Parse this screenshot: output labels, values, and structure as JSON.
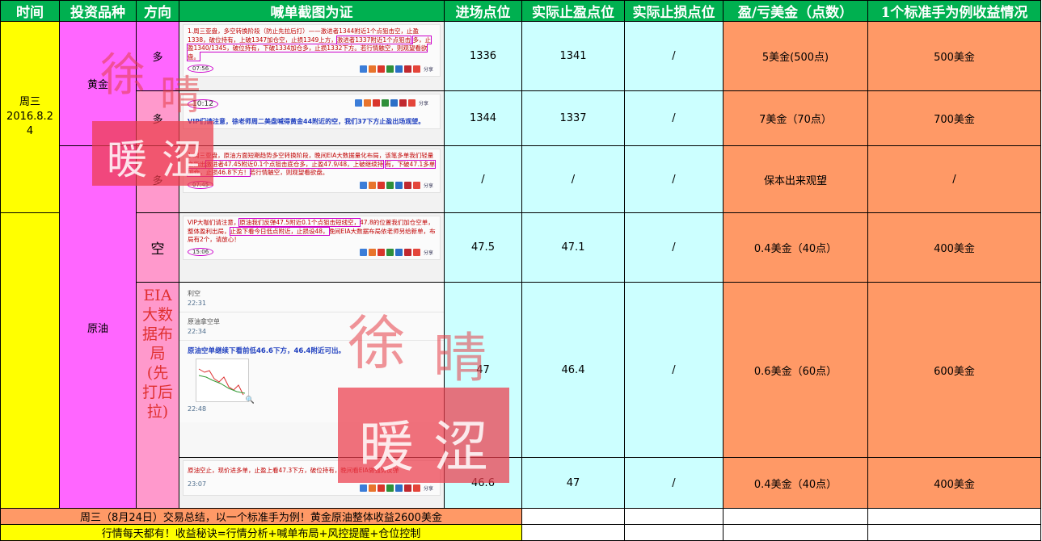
{
  "headers": [
    "时间",
    "投资品种",
    "方向",
    "喊单截图为证",
    "进场点位",
    "实际止盈点位",
    "实际止损点位",
    "盈/亏美金（点数）",
    "1个标准手为例收益情况"
  ],
  "date_cell": "周三\n2016.8.24",
  "instruments": {
    "gold": "黄金",
    "oil": "原油"
  },
  "eia_label": "EIA大数据布局(先打后拉)",
  "rows": [
    {
      "direction": "多",
      "entry": "1336",
      "tp": "1341",
      "sl": "/",
      "pl": "5美金(500点)",
      "profit": "500美金",
      "shot": {
        "line1": "1.周三亚盘，多空转换阶段（防止先拉后打）——激进者1344附近1个点狙击空，止盈1338，破位持有，上破1347加仓空，止损1349上方，",
        "hl1": "激进者1337附近1个点狙击",
        "line2": "多，止盈1340/1345，破位持有，下破1334加仓多，止损1332下方。若行情触空，则观望看欲盘。",
        "time": "07:56"
      }
    },
    {
      "direction": "多",
      "entry": "1344",
      "tp": "1337",
      "sl": "/",
      "pl": "7美金（70点）",
      "profit": "700美金",
      "shot": {
        "time": "10:12",
        "line1": "VIP们请注意，徐老师周二美盘喊得黄金44附近的空，我们37下方止盈出场观望。"
      }
    },
    {
      "direction": "多",
      "entry": "/",
      "tp": "/",
      "sl": "/",
      "pl": "保本出来观望",
      "profit": "/",
      "shot": {
        "line1": "1.周三亚盘，原油方面短期趋势多空转换阶段，晚间EIA大数据量化布局，该笔多单我们轻量之能出",
        "hl1": "激进者47.45附近0.1个点狙击底仓多，止盈47.9/48，上破继续持",
        "line2": "有，下破47.1多单加仓，止损46.8下方！",
        "line3": "若行情触空，则观望看欲盘。",
        "time": "07:45"
      }
    },
    {
      "direction": "空",
      "entry": "47.5",
      "tp": "47.1",
      "sl": "/",
      "pl": "0.4美金（40点）",
      "profit": "400美金",
      "shot": {
        "line1": "VIP大咖们请注意，",
        "hl1": "原油我们反弹47.5附近0.1个点狙击短线空，",
        "line2": "47.8的位置我们加仓空单，整体盈利出局，",
        "hl2": "止盈下看今日低点附近，止损设48，",
        "line3": "晚间EIA大数据布局依老师另给新单，布局有2个，请放心！",
        "time": "15:06"
      }
    },
    {
      "entry": "47",
      "tp": "46.4",
      "sl": "/",
      "pl": "0.6美金（60点）",
      "profit": "600美金",
      "shot": {
        "c1": "利空",
        "t1": "22:31",
        "c2": "原油拿空单",
        "t2": "22:34",
        "c3": "原油空单继续下看前低46.6下方，46.4附近可出。",
        "t3": "22:48"
      }
    },
    {
      "entry": "46.6",
      "tp": "47",
      "sl": "/",
      "pl": "0.4美金（40点）",
      "profit": "400美金",
      "shot": {
        "line1": "原油空止，现价进多单，止盈上看47.3下方，破位持有，晚间看EIA做强势反弹",
        "time": "23:07"
      }
    }
  ],
  "summary1": "周三（8月24日）交易总结，以一个标准手为例！黄金原油整体收益2600美金",
  "summary2": "行情每天都有！收益秘诀=行情分析+喊单布局+风控提醒+仓位控制",
  "share_label": "分享",
  "watermark_chars": [
    "徐",
    "晴",
    "暖",
    "涩"
  ],
  "colors": {
    "header": "#00b050",
    "yellow": "#ffff00",
    "pink": "#ff99cc",
    "magenta": "#ff66ff",
    "cyan": "#ccffff",
    "orange": "#ff9966",
    "red_text": "#c00000",
    "blue_text": "#1f3fbf",
    "highlight": "#cc00cc"
  }
}
